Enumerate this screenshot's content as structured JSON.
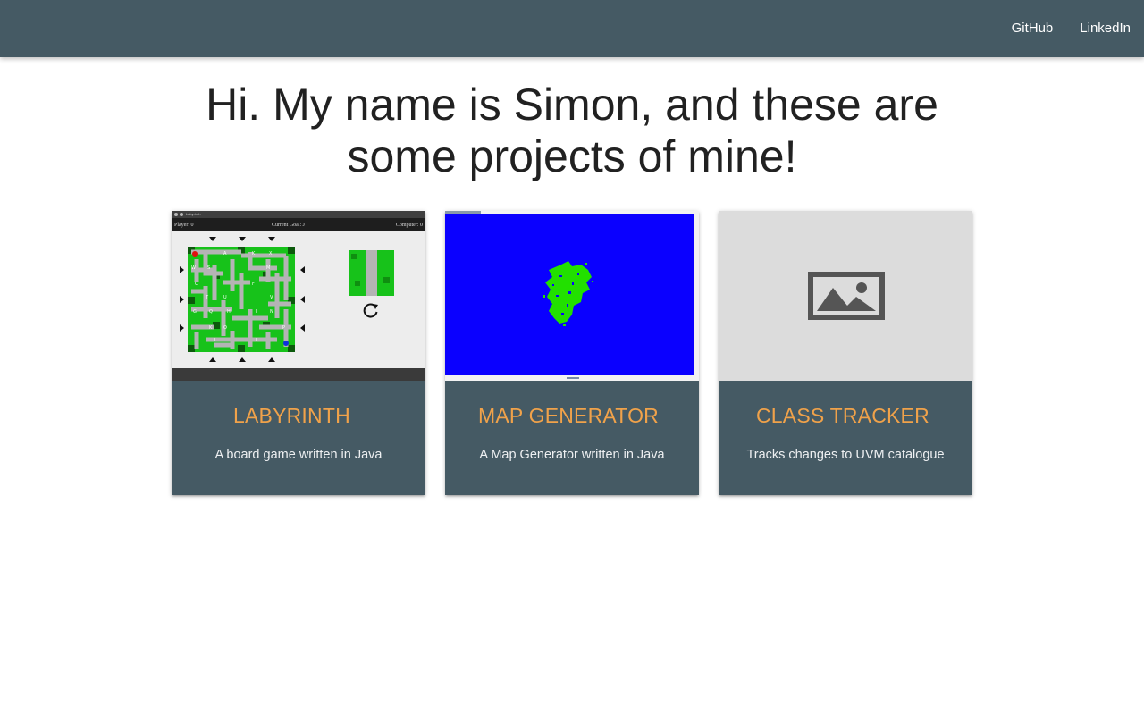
{
  "nav": {
    "links": [
      {
        "label": "GitHub"
      },
      {
        "label": "LinkedIn"
      }
    ]
  },
  "hero": {
    "line1": "Hi. My name is Simon, and these are",
    "line2": "some projects of mine!"
  },
  "projects": [
    {
      "title": "LABYRINTH",
      "description": "A board game written in Java",
      "image": {
        "window_title": "Labyrinth",
        "player_score": "Player: 0",
        "current_goal": "Current Goal: J",
        "computer_score": "Computer: 0"
      }
    },
    {
      "title": "MAP GENERATOR",
      "description": "A Map Generator written in Java"
    },
    {
      "title": "CLASS TRACKER",
      "description": "Tracks changes to UVM catalogue",
      "image": {
        "icon": "image-placeholder-icon"
      }
    }
  ],
  "colors": {
    "navbar": "#455a64",
    "card": "#455a64",
    "card_title": "#f0a24a",
    "map_water": "#0a00ff",
    "map_land": "#22e000"
  }
}
